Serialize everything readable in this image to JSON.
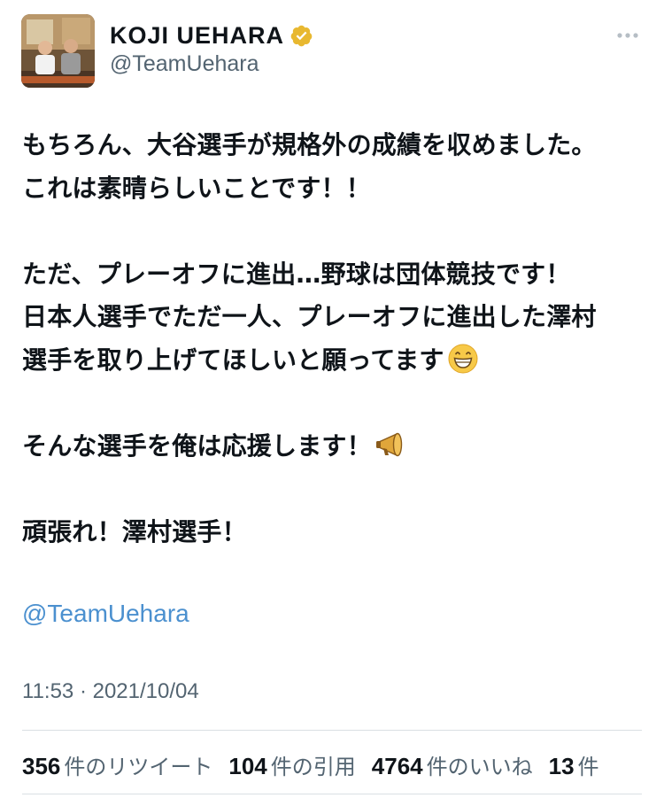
{
  "author": {
    "display_name": "KOJI  UEHARA",
    "handle": "@TeamUehara",
    "verified": true
  },
  "tweet": {
    "lines": [
      "もちろん、大谷選手が規格外の成績を収めました。",
      "これは素晴らしいことです！！",
      "",
      "ただ、プレーオフに進出…野球は団体競技です！",
      "日本人選手でただ一人、プレーオフに進出した澤村",
      "選手を取り上げてほしいと願ってます",
      "",
      "そんな選手を俺は応援します！",
      "",
      "頑張れ！澤村選手！"
    ],
    "mention": "@TeamUehara",
    "timestamp": "11:53 · 2021/10/04"
  },
  "stats": [
    {
      "count": "356",
      "label": "件のリツイート"
    },
    {
      "count": "104",
      "label": "件の引用"
    },
    {
      "count": "4764",
      "label": "件のいいね"
    },
    {
      "count": "13",
      "label": "件"
    }
  ],
  "icons": {
    "verified": "verified-badge-icon",
    "more": "more-options-icon",
    "emoji_grin": "grinning-face-emoji",
    "emoji_megaphone": "megaphone-emoji"
  },
  "colors": {
    "mention": "#4b90cf",
    "verified": "#e8b830",
    "secondary_text": "#536471"
  }
}
